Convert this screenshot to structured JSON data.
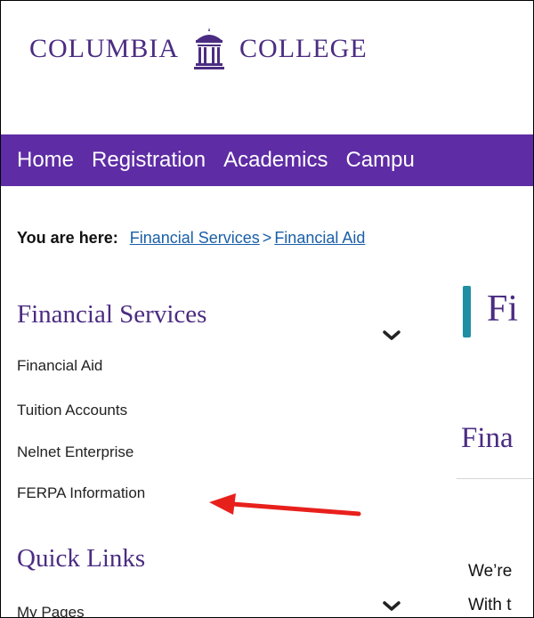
{
  "header": {
    "logo_left": "COLUMBIA",
    "logo_right": "COLLEGE",
    "logo_icon": "gazebo-icon",
    "brand_color": "#4b2c82"
  },
  "nav": {
    "items": [
      "Home",
      "Registration",
      "Academics",
      "Campu"
    ],
    "bg_color": "#5e2ca5"
  },
  "breadcrumb": {
    "lead": "You are here:",
    "links": [
      "Financial Services",
      "Financial Aid"
    ],
    "separator": ">"
  },
  "sidebar": {
    "section1": {
      "heading": "Financial Services",
      "items": [
        "Financial Aid",
        "Tuition Accounts",
        "Nelnet Enterprise",
        "FERPA Information"
      ]
    },
    "section2": {
      "heading": "Quick Links",
      "items": [
        "My Pages"
      ]
    },
    "expand_icon": "chevron-down-icon"
  },
  "main": {
    "title": "Fi",
    "subtitle": "Fina",
    "paragraphs": [
      "We’re",
      "With t"
    ],
    "accent_color": "#1f8ea3"
  },
  "annotation": {
    "icon": "red-arrow-icon",
    "color": "#e8201c"
  }
}
